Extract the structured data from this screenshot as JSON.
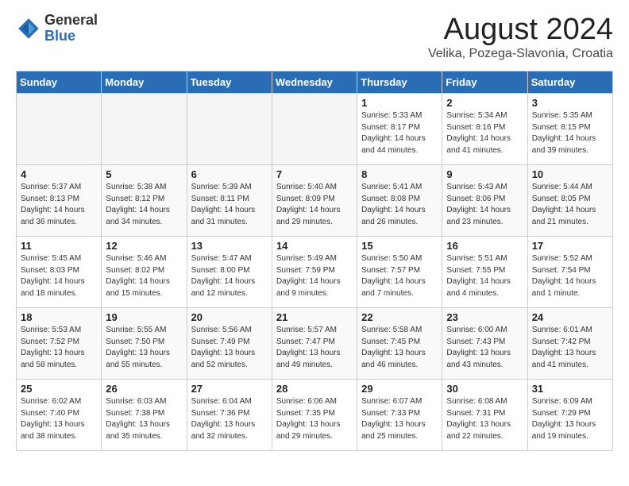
{
  "logo": {
    "general": "General",
    "blue": "Blue"
  },
  "title": "August 2024",
  "location": "Velika, Pozega-Slavonia, Croatia",
  "headers": [
    "Sunday",
    "Monday",
    "Tuesday",
    "Wednesday",
    "Thursday",
    "Friday",
    "Saturday"
  ],
  "weeks": [
    [
      {
        "day": "",
        "info": ""
      },
      {
        "day": "",
        "info": ""
      },
      {
        "day": "",
        "info": ""
      },
      {
        "day": "",
        "info": ""
      },
      {
        "day": "1",
        "info": "Sunrise: 5:33 AM\nSunset: 8:17 PM\nDaylight: 14 hours\nand 44 minutes."
      },
      {
        "day": "2",
        "info": "Sunrise: 5:34 AM\nSunset: 8:16 PM\nDaylight: 14 hours\nand 41 minutes."
      },
      {
        "day": "3",
        "info": "Sunrise: 5:35 AM\nSunset: 8:15 PM\nDaylight: 14 hours\nand 39 minutes."
      }
    ],
    [
      {
        "day": "4",
        "info": "Sunrise: 5:37 AM\nSunset: 8:13 PM\nDaylight: 14 hours\nand 36 minutes."
      },
      {
        "day": "5",
        "info": "Sunrise: 5:38 AM\nSunset: 8:12 PM\nDaylight: 14 hours\nand 34 minutes."
      },
      {
        "day": "6",
        "info": "Sunrise: 5:39 AM\nSunset: 8:11 PM\nDaylight: 14 hours\nand 31 minutes."
      },
      {
        "day": "7",
        "info": "Sunrise: 5:40 AM\nSunset: 8:09 PM\nDaylight: 14 hours\nand 29 minutes."
      },
      {
        "day": "8",
        "info": "Sunrise: 5:41 AM\nSunset: 8:08 PM\nDaylight: 14 hours\nand 26 minutes."
      },
      {
        "day": "9",
        "info": "Sunrise: 5:43 AM\nSunset: 8:06 PM\nDaylight: 14 hours\nand 23 minutes."
      },
      {
        "day": "10",
        "info": "Sunrise: 5:44 AM\nSunset: 8:05 PM\nDaylight: 14 hours\nand 21 minutes."
      }
    ],
    [
      {
        "day": "11",
        "info": "Sunrise: 5:45 AM\nSunset: 8:03 PM\nDaylight: 14 hours\nand 18 minutes."
      },
      {
        "day": "12",
        "info": "Sunrise: 5:46 AM\nSunset: 8:02 PM\nDaylight: 14 hours\nand 15 minutes."
      },
      {
        "day": "13",
        "info": "Sunrise: 5:47 AM\nSunset: 8:00 PM\nDaylight: 14 hours\nand 12 minutes."
      },
      {
        "day": "14",
        "info": "Sunrise: 5:49 AM\nSunset: 7:59 PM\nDaylight: 14 hours\nand 9 minutes."
      },
      {
        "day": "15",
        "info": "Sunrise: 5:50 AM\nSunset: 7:57 PM\nDaylight: 14 hours\nand 7 minutes."
      },
      {
        "day": "16",
        "info": "Sunrise: 5:51 AM\nSunset: 7:55 PM\nDaylight: 14 hours\nand 4 minutes."
      },
      {
        "day": "17",
        "info": "Sunrise: 5:52 AM\nSunset: 7:54 PM\nDaylight: 14 hours\nand 1 minute."
      }
    ],
    [
      {
        "day": "18",
        "info": "Sunrise: 5:53 AM\nSunset: 7:52 PM\nDaylight: 13 hours\nand 58 minutes."
      },
      {
        "day": "19",
        "info": "Sunrise: 5:55 AM\nSunset: 7:50 PM\nDaylight: 13 hours\nand 55 minutes."
      },
      {
        "day": "20",
        "info": "Sunrise: 5:56 AM\nSunset: 7:49 PM\nDaylight: 13 hours\nand 52 minutes."
      },
      {
        "day": "21",
        "info": "Sunrise: 5:57 AM\nSunset: 7:47 PM\nDaylight: 13 hours\nand 49 minutes."
      },
      {
        "day": "22",
        "info": "Sunrise: 5:58 AM\nSunset: 7:45 PM\nDaylight: 13 hours\nand 46 minutes."
      },
      {
        "day": "23",
        "info": "Sunrise: 6:00 AM\nSunset: 7:43 PM\nDaylight: 13 hours\nand 43 minutes."
      },
      {
        "day": "24",
        "info": "Sunrise: 6:01 AM\nSunset: 7:42 PM\nDaylight: 13 hours\nand 41 minutes."
      }
    ],
    [
      {
        "day": "25",
        "info": "Sunrise: 6:02 AM\nSunset: 7:40 PM\nDaylight: 13 hours\nand 38 minutes."
      },
      {
        "day": "26",
        "info": "Sunrise: 6:03 AM\nSunset: 7:38 PM\nDaylight: 13 hours\nand 35 minutes."
      },
      {
        "day": "27",
        "info": "Sunrise: 6:04 AM\nSunset: 7:36 PM\nDaylight: 13 hours\nand 32 minutes."
      },
      {
        "day": "28",
        "info": "Sunrise: 6:06 AM\nSunset: 7:35 PM\nDaylight: 13 hours\nand 29 minutes."
      },
      {
        "day": "29",
        "info": "Sunrise: 6:07 AM\nSunset: 7:33 PM\nDaylight: 13 hours\nand 25 minutes."
      },
      {
        "day": "30",
        "info": "Sunrise: 6:08 AM\nSunset: 7:31 PM\nDaylight: 13 hours\nand 22 minutes."
      },
      {
        "day": "31",
        "info": "Sunrise: 6:09 AM\nSunset: 7:29 PM\nDaylight: 13 hours\nand 19 minutes."
      }
    ]
  ]
}
